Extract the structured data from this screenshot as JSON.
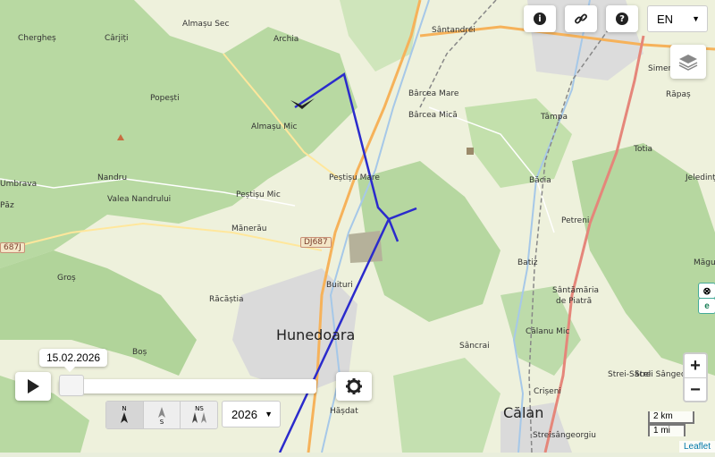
{
  "map": {
    "places": [
      {
        "name": "Chergheș",
        "cls": "p1"
      },
      {
        "name": "Cârjiți",
        "cls": "p2"
      },
      {
        "name": "Almașu Sec",
        "cls": "p3"
      },
      {
        "name": "Archia",
        "cls": "p4"
      },
      {
        "name": "Sântandrei",
        "cls": "p5"
      },
      {
        "name": "Popești",
        "cls": "p6"
      },
      {
        "name": "Bârcea Mare",
        "cls": "p7"
      },
      {
        "name": "Bârcea Mică",
        "cls": "p8"
      },
      {
        "name": "Almașu Mic",
        "cls": "p9"
      },
      {
        "name": "Tâmpa",
        "cls": "p10"
      },
      {
        "name": "Totia",
        "cls": "p11"
      },
      {
        "name": "Răpaș",
        "cls": "p12"
      },
      {
        "name": "Simeria Veche",
        "cls": "p13"
      },
      {
        "name": "Umbrava",
        "cls": "p14"
      },
      {
        "name": "Nandru",
        "cls": "p15"
      },
      {
        "name": "Peștișu Mare",
        "cls": "p16"
      },
      {
        "name": "Băcia",
        "cls": "p17"
      },
      {
        "name": "Jeledinț",
        "cls": "p18"
      },
      {
        "name": "Valea Nandrului",
        "cls": "p19"
      },
      {
        "name": "Peștișu Mic",
        "cls": "p20"
      },
      {
        "name": "Petreni",
        "cls": "p21"
      },
      {
        "name": "Mănerău",
        "cls": "p22"
      },
      {
        "name": "Batiz",
        "cls": "p23"
      },
      {
        "name": "Măgu",
        "cls": "p24"
      },
      {
        "name": "Groș",
        "cls": "p25"
      },
      {
        "name": "Buituri",
        "cls": "p26"
      },
      {
        "name": "Sântămăria",
        "cls": "p27"
      },
      {
        "name": "de Piatră",
        "cls": "p28"
      },
      {
        "name": "Răcăștia",
        "cls": "p29"
      },
      {
        "name": "Călanu Mic",
        "cls": "p30"
      },
      {
        "name": "Sâncrai",
        "cls": "p31"
      },
      {
        "name": "Boș",
        "cls": "p32"
      },
      {
        "name": "Strei-Săcel",
        "cls": "p33"
      },
      {
        "name": "Strei Sângeorgiu",
        "cls": "p34"
      },
      {
        "name": "Crișeni",
        "cls": "p35"
      },
      {
        "name": "Hășdat",
        "cls": "p36"
      },
      {
        "name": "Streisângeorgiu",
        "cls": "p37"
      },
      {
        "name": "Păz",
        "cls": "p38"
      }
    ],
    "city_hunedoara": "Hunedoara",
    "city_calan": "Călan",
    "road_dj687": "DJ687",
    "road_687j": "687J"
  },
  "controls": {
    "info_icon": "info-icon",
    "link_icon": "link-icon",
    "help_icon": "help-icon",
    "language": "EN",
    "zoom_in": "+",
    "zoom_out": "−",
    "scale_km": "2 km",
    "scale_mi": "1 mi",
    "attribution": "Leaflet"
  },
  "timeline": {
    "date": "15.02.2026",
    "year": "2026",
    "progress": 0.0,
    "orientation": [
      "N",
      "S",
      "NS"
    ]
  },
  "colors": {
    "route": "#2b2bcc",
    "forest": "#b6d9a0",
    "road": "#f5a623"
  }
}
